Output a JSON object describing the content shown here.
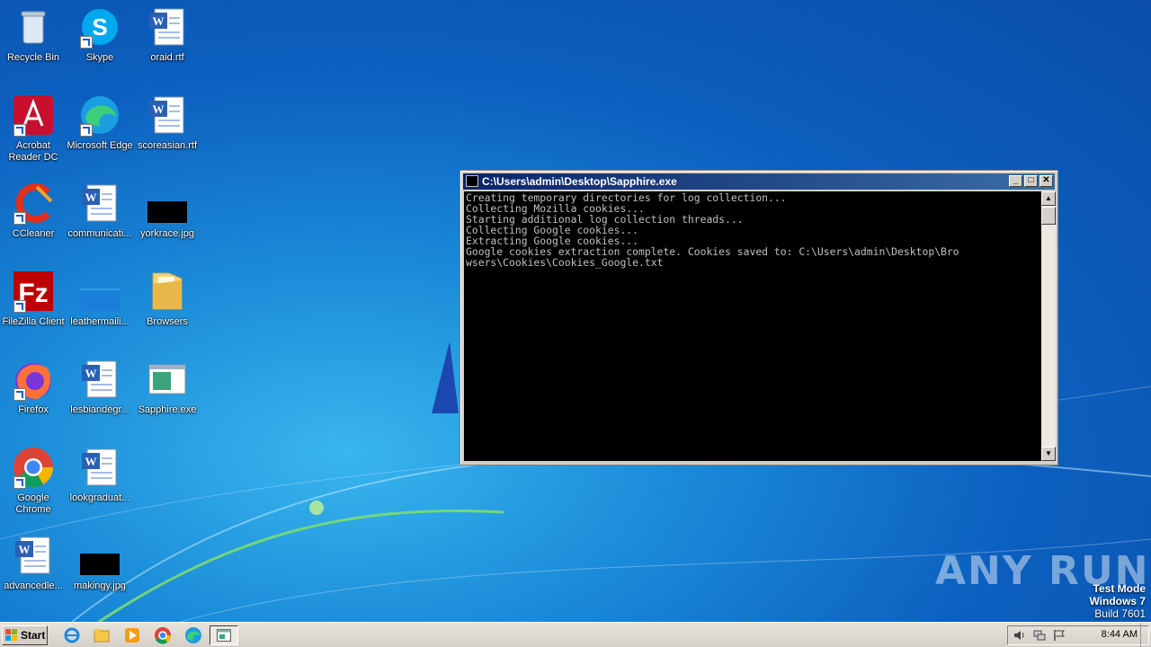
{
  "desktop": {
    "icons": [
      {
        "label": "Recycle Bin"
      },
      {
        "label": "Skype"
      },
      {
        "label": "oraid.rtf"
      },
      {
        "label": "Acrobat Reader DC"
      },
      {
        "label": "Microsoft Edge"
      },
      {
        "label": "scoreasian.rtf"
      },
      {
        "label": "CCleaner"
      },
      {
        "label": "communicati..."
      },
      {
        "label": "yorkrace.jpg"
      },
      {
        "label": "FileZilla Client"
      },
      {
        "label": "leathermaili..."
      },
      {
        "label": "Browsers"
      },
      {
        "label": "Firefox"
      },
      {
        "label": "lesbiandegr..."
      },
      {
        "label": "Sapphire.exe"
      },
      {
        "label": "Google Chrome"
      },
      {
        "label": "lookgraduat..."
      },
      {
        "label": "advancedle..."
      },
      {
        "label": "makingy.jpg"
      }
    ]
  },
  "console": {
    "title": "C:\\Users\\admin\\Desktop\\Sapphire.exe",
    "lines": [
      "Creating temporary directories for log collection...",
      "Collecting Mozilla cookies...",
      "Starting additional log collection threads...",
      "Collecting Google cookies...",
      "Extracting Google cookies...",
      "Google cookies extraction complete. Cookies saved to: C:\\Users\\admin\\Desktop\\Bro",
      "wsers\\Cookies\\Cookies_Google.txt"
    ]
  },
  "watermark": {
    "text": "ANY RUN"
  },
  "test_mode": {
    "line1": "Test Mode",
    "line2": "Windows 7",
    "line3": "Build 7601"
  },
  "taskbar": {
    "start_label": "Start",
    "clock": "8:44 AM"
  },
  "colors": {
    "console_bg": "#000000",
    "console_text": "#c0c0c0",
    "title_active": "#0a246a"
  }
}
